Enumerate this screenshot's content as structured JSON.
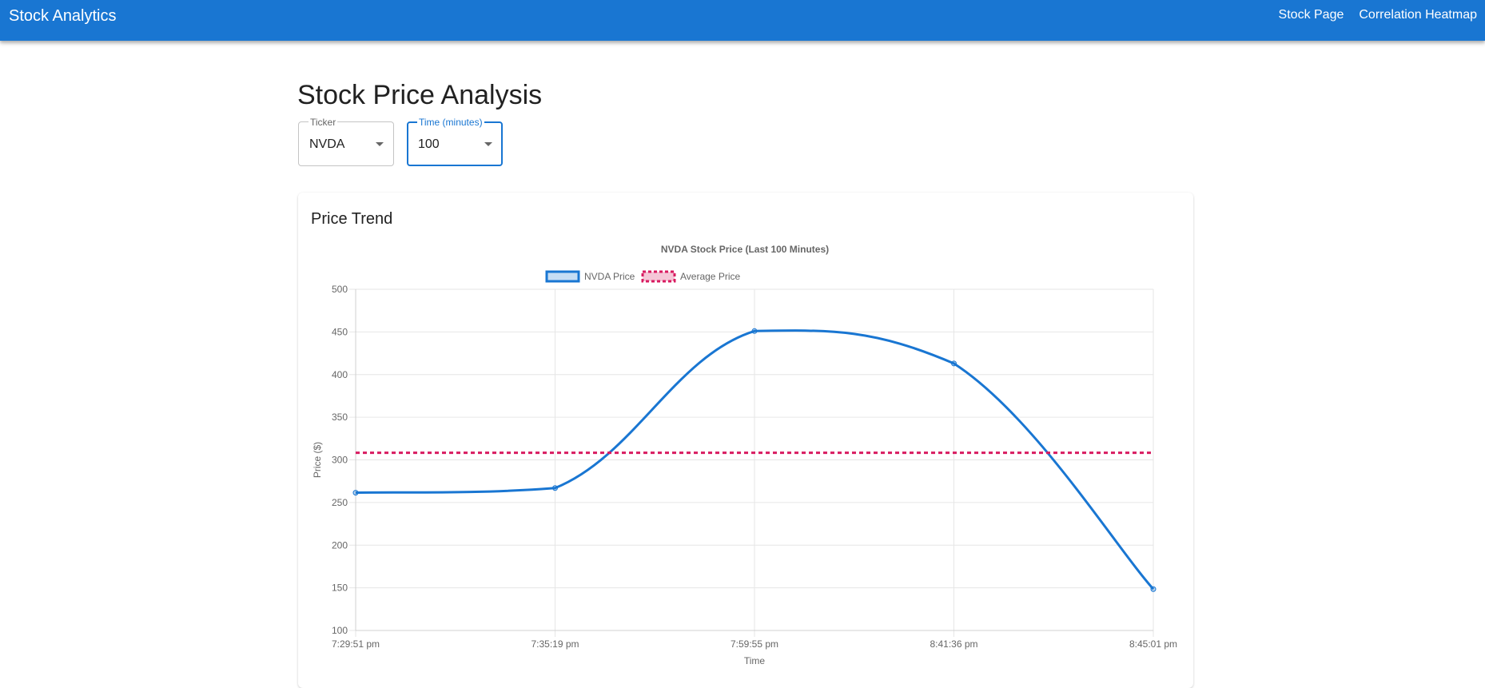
{
  "app": {
    "title": "Stock Analytics",
    "nav": [
      "Stock Page",
      "Correlation Heatmap"
    ],
    "brand_color": "#1976d2"
  },
  "page": {
    "title": "Stock Price Analysis"
  },
  "controls": {
    "ticker": {
      "label": "Ticker",
      "value": "NVDA"
    },
    "time": {
      "label": "Time (minutes)",
      "value": "100"
    }
  },
  "card": {
    "title": "Price Trend"
  },
  "chart_data": {
    "type": "line",
    "title": "NVDA Stock Price (Last 100 Minutes)",
    "xlabel": "Time",
    "ylabel": "Price ($)",
    "ylim": [
      100,
      500
    ],
    "y_ticks": [
      100,
      150,
      200,
      250,
      300,
      350,
      400,
      450,
      500
    ],
    "grid": true,
    "legend_position": "top",
    "categories": [
      "7:29:51 pm",
      "7:35:19 pm",
      "7:59:55 pm",
      "8:41:36 pm",
      "8:45:01 pm"
    ],
    "series": [
      {
        "name": "NVDA Price",
        "values": [
          261.5,
          267,
          451,
          413,
          148.5
        ],
        "color": "#1976d2",
        "style": "solid"
      },
      {
        "name": "Average Price",
        "values": [
          308.3,
          308.3,
          308.3,
          308.3,
          308.3
        ],
        "color": "#d81b60",
        "style": "dashed"
      }
    ]
  }
}
